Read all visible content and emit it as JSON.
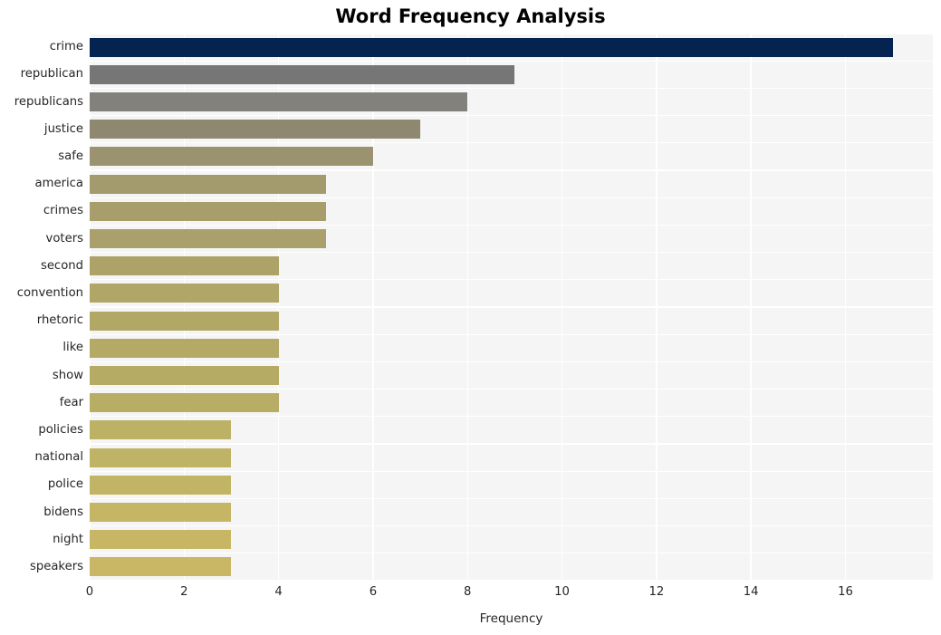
{
  "chart_data": {
    "type": "bar",
    "orientation": "horizontal",
    "title": "Word Frequency Analysis",
    "xlabel": "Frequency",
    "ylabel": "",
    "categories": [
      "crime",
      "republican",
      "republicans",
      "justice",
      "safe",
      "america",
      "crimes",
      "voters",
      "second",
      "convention",
      "rhetoric",
      "like",
      "show",
      "fear",
      "policies",
      "national",
      "police",
      "bidens",
      "night",
      "speakers"
    ],
    "values": [
      17,
      9,
      8,
      7,
      6,
      5,
      5,
      5,
      4,
      4,
      4,
      4,
      4,
      4,
      3,
      3,
      3,
      3,
      3,
      3
    ],
    "bar_colors": [
      "#042351",
      "#767676",
      "#83817b",
      "#8d886f",
      "#9b9370",
      "#a39a6d",
      "#a79e6c",
      "#a9a06b",
      "#ada368",
      "#b0a667",
      "#b2a866",
      "#b4aa66",
      "#b6ab65",
      "#b8ad65",
      "#bdb165",
      "#bfb365",
      "#c1b565",
      "#c4b665",
      "#c7b765",
      "#c9b765"
    ],
    "xlim": [
      0,
      17.85
    ],
    "xticks": [
      "0",
      "2",
      "4",
      "6",
      "8",
      "10",
      "12",
      "14",
      "16"
    ],
    "xtick_values": [
      0,
      2,
      4,
      6,
      8,
      10,
      12,
      14,
      16
    ],
    "grid": true,
    "grid_color": "#ffffff",
    "plot_background": "#f5f5f5",
    "figure_background": "#ffffff",
    "legend": null,
    "style": "whitegrid"
  }
}
